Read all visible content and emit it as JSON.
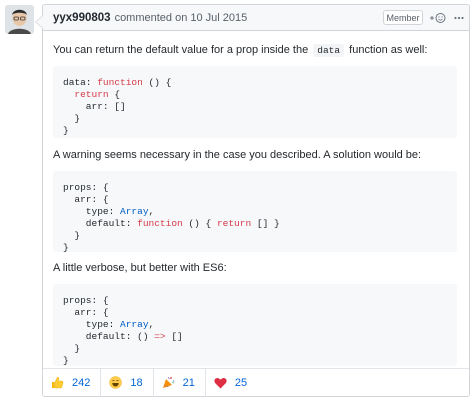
{
  "comment": {
    "author": "yyx990803",
    "action": "commented on",
    "date": "10 Jul 2015",
    "badge": "Member",
    "paragraph1_before": "You can return the default value for a prop inside the",
    "paragraph1_code": "data",
    "paragraph1_after": "function as well:",
    "paragraph2": "A warning seems necessary in the case you described. A solution would be:",
    "paragraph3": "A little verbose, but better with ES6:"
  },
  "reactions": [
    {
      "icon": "thumbs-up-icon",
      "count": "242"
    },
    {
      "icon": "laugh-icon",
      "count": "18"
    },
    {
      "icon": "hooray-icon",
      "count": "21"
    },
    {
      "icon": "heart-icon",
      "count": "25"
    }
  ]
}
